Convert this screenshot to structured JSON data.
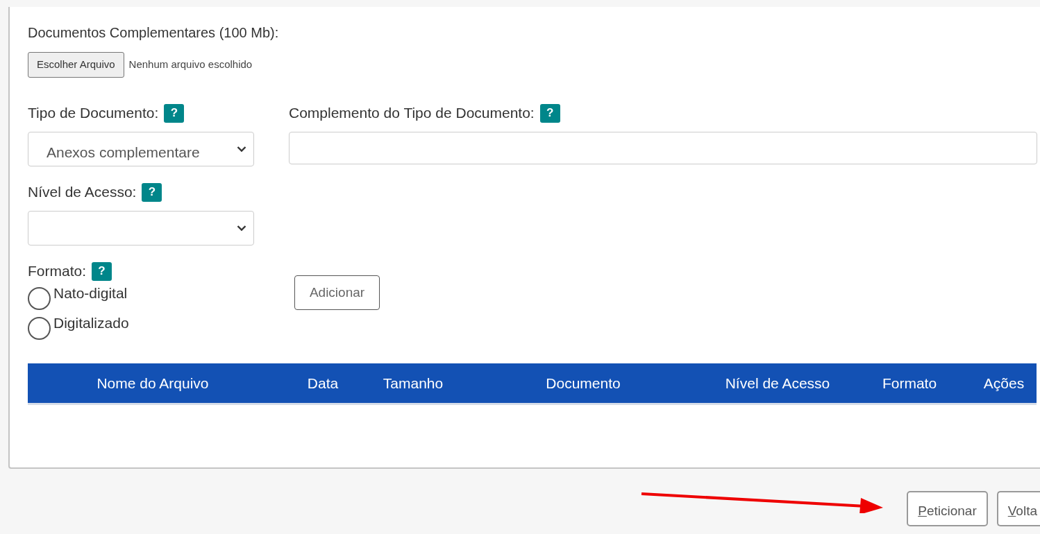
{
  "upload": {
    "label": "Documentos Complementares (100 Mb):",
    "button": "Escolher Arquivo",
    "status": "Nenhum arquivo escolhido"
  },
  "fields": {
    "tipo": {
      "label": "Tipo de Documento:",
      "help": "?",
      "value": "Anexos complementare"
    },
    "complemento": {
      "label": "Complemento do Tipo de Documento:",
      "help": "?"
    },
    "nivel": {
      "label": "Nível de Acesso:",
      "help": "?"
    },
    "formato": {
      "label": "Formato:",
      "help": "?",
      "options": [
        {
          "label": "Nato-digital",
          "selected": false
        },
        {
          "label": "Digitalizado",
          "selected": false
        }
      ]
    }
  },
  "add_button": "Adicionar",
  "table": {
    "columns": [
      "Nome do Arquivo",
      "Data",
      "Tamanho",
      "Documento",
      "Nível de Acesso",
      "Formato",
      "Ações"
    ]
  },
  "buttons": [
    "Peticionar",
    "Volta"
  ]
}
